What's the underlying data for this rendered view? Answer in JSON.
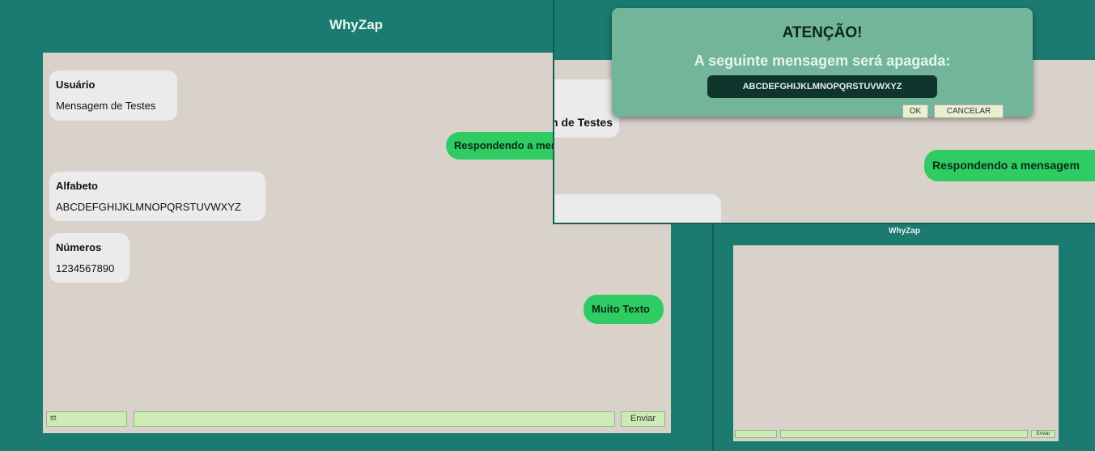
{
  "left_window": {
    "title": "WhyZap",
    "messages_in": [
      {
        "user": "Usuário",
        "text": "Mensagem de Testes"
      },
      {
        "user": "Alfabeto",
        "text": "ABCDEFGHIJKLMNOPQRSTUVWXYZ"
      },
      {
        "user": "Números",
        "text": "1234567890"
      }
    ],
    "messages_out": [
      {
        "text": "Respondendo a mensagem"
      },
      {
        "text": "Muito Texto"
      }
    ],
    "name_field_value": "ttt",
    "message_field_value": "",
    "send_label": "Enviar"
  },
  "top_right_window": {
    "messages_in": [
      {
        "text": "Mensagem de Testes"
      }
    ],
    "messages_out": [
      {
        "text": "Respondendo a mensagem"
      }
    ]
  },
  "bottom_right_window": {
    "title": "WhyZap",
    "name_field_value": "",
    "message_field_value": "",
    "send_label": "Enviar"
  },
  "dialog": {
    "title": "ATENÇÃO!",
    "message": "A seguinte mensagem será apagada:",
    "quoted_message": "ABCDEFGHIJKLMNOPQRSTUVWXYZ",
    "ok_label": "OK",
    "cancel_label": "CANCELAR"
  },
  "colors": {
    "frame": "#1b7b70",
    "chat_background": "#d9d2cb",
    "incoming_bubble": "#ebebeb",
    "outgoing_bubble": "#2ecc62",
    "input_field": "#cdebb4",
    "dialog_background": "#72b59b",
    "dialog_code_background": "#0f362d"
  }
}
